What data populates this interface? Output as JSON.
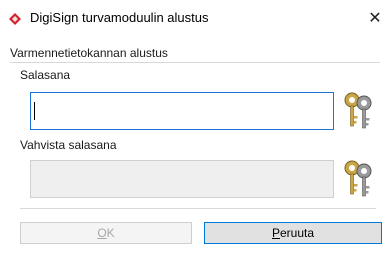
{
  "window": {
    "title": "DigiSign turvamoduulin alustus",
    "close_glyph": "✕",
    "icon": "digisign-logo-icon"
  },
  "section": {
    "title": "Varmennetietokannan alustus"
  },
  "password": {
    "label": "Salasana",
    "value": "",
    "icon": "keys-icon"
  },
  "confirm": {
    "label": "Vahvista salasana",
    "value": "",
    "icon": "keys-icon"
  },
  "buttons": {
    "ok_mnemonic": "O",
    "ok_rest": "K",
    "cancel_mnemonic": "P",
    "cancel_rest": "eruuta"
  },
  "colors": {
    "accent": "#1a73d6",
    "logo_red": "#d2232a"
  }
}
